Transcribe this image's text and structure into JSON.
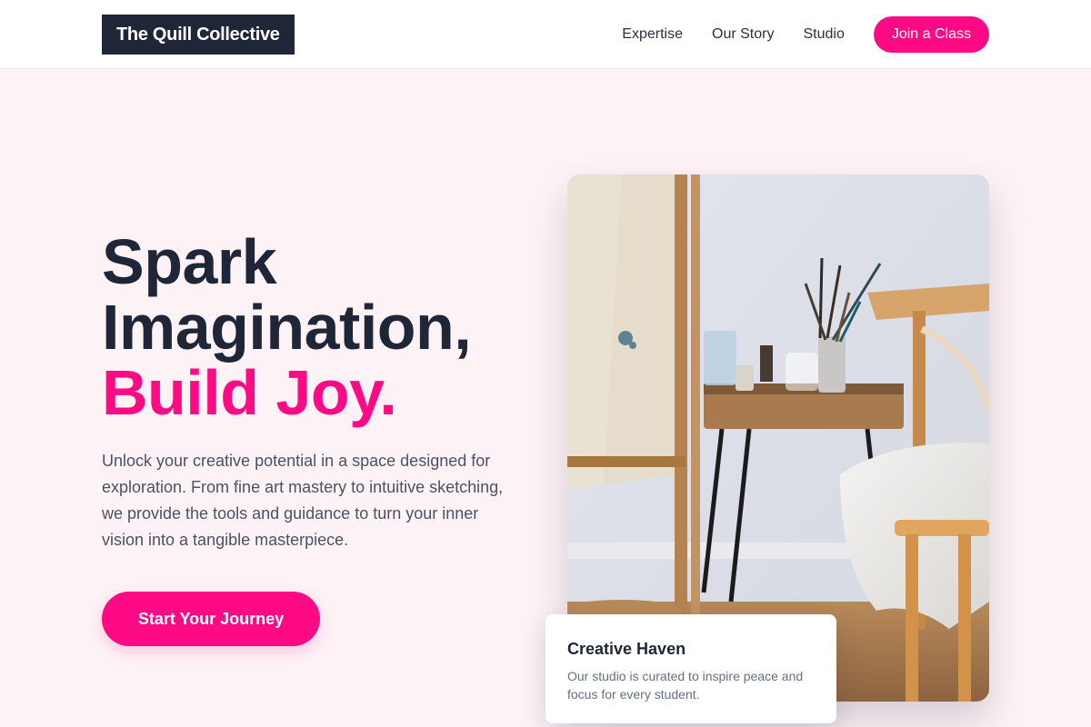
{
  "header": {
    "logo": "The Quill Collective",
    "nav": [
      "Expertise",
      "Our Story",
      "Studio"
    ],
    "cta": "Join a Class"
  },
  "hero": {
    "title_line1": "Spark",
    "title_line2": "Imagination,",
    "title_accent": "Build Joy.",
    "description": "Unlock your creative potential in a space designed for exploration. From fine art mastery to intuitive sketching, we provide the tools and guidance to turn your inner vision into a tangible masterpiece.",
    "cta": "Start Your Journey"
  },
  "card": {
    "title": "Creative Haven",
    "text": "Our studio is curated to inspire peace and focus for every student."
  },
  "colors": {
    "accent": "#ff0a85",
    "dark": "#1e2638",
    "background": "#fdf2f6"
  }
}
